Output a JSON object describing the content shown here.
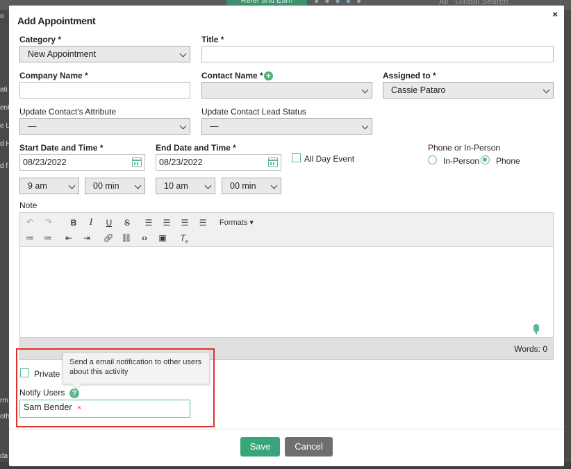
{
  "background": {
    "pill_label": "Refer and Earn",
    "search_scope": "All",
    "search_placeholder": "Global Search",
    "left_fragments": [
      "o",
      "ati",
      "ent",
      "e L",
      "d H",
      "d f",
      "rm",
      "oth",
      "da"
    ]
  },
  "modal": {
    "title": "Add Appointment",
    "close_label": "×"
  },
  "form": {
    "category": {
      "label": "Category *",
      "value": "New Appointment"
    },
    "title": {
      "label": "Title *",
      "value": ""
    },
    "company_name": {
      "label": "Company Name *",
      "value": ""
    },
    "contact_name": {
      "label": "Contact Name *",
      "value": ""
    },
    "assigned_to": {
      "label": "Assigned to *",
      "value": "Cassie Pataro"
    },
    "update_attribute": {
      "label": "Update Contact's Attribute",
      "value": "—"
    },
    "update_lead_status": {
      "label": "Update Contact Lead Status",
      "value": "—"
    },
    "start": {
      "label": "Start Date and Time *",
      "date": "08/23/2022",
      "hour": "9 am",
      "minute": "00 min"
    },
    "end": {
      "label": "End Date and Time *",
      "date": "08/23/2022",
      "hour": "10 am",
      "minute": "00 min"
    },
    "all_day": {
      "label": "All Day Event",
      "checked": false
    },
    "meeting_type": {
      "label": "Phone or In-Person",
      "options": [
        {
          "label": "In-Person",
          "selected": false
        },
        {
          "label": "Phone",
          "selected": true
        }
      ]
    },
    "note": {
      "label": "Note",
      "formats_label": "Formats",
      "word_count": "Words: 0"
    },
    "private": {
      "label": "Private",
      "checked": false
    },
    "notify_users": {
      "label": "Notify Users",
      "tooltip": "Send a email notification to other users about this activity",
      "tokens": [
        "Sam Bender"
      ],
      "remove_glyph": "×"
    }
  },
  "buttons": {
    "save": "Save",
    "cancel": "Cancel"
  },
  "colors": {
    "accent": "#5cb88f",
    "save": "#3aa57a",
    "cancel": "#6f6f6f",
    "highlight": "#e0302a"
  }
}
